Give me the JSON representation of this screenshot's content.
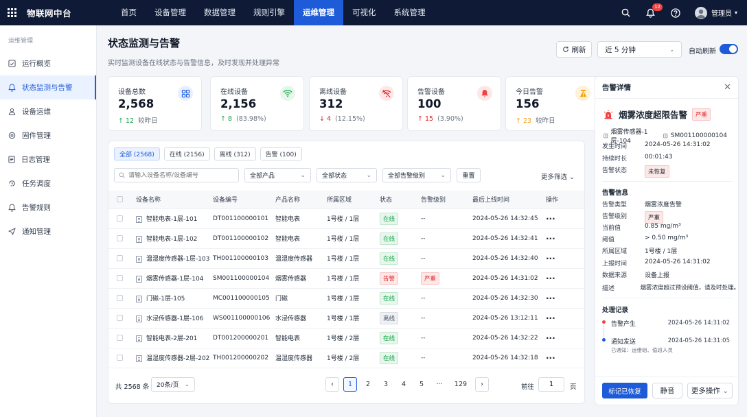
{
  "app": {
    "brand": "物联网中台"
  },
  "nav": [
    {
      "label": "首页",
      "active": false
    },
    {
      "label": "设备管理",
      "active": false
    },
    {
      "label": "数据管理",
      "active": false
    },
    {
      "label": "规则引擎",
      "active": false
    },
    {
      "label": "运维管理",
      "active": true
    },
    {
      "label": "可视化",
      "active": false
    },
    {
      "label": "系统管理",
      "active": false
    }
  ],
  "topbar": {
    "notif_count": "12",
    "username": "管理员"
  },
  "sidebar": {
    "title": "运维管理",
    "items": [
      {
        "label": "运行概览",
        "icon": "chart-icon"
      },
      {
        "label": "状态监测与告警",
        "icon": "bell-icon",
        "active": true
      },
      {
        "label": "设备运维",
        "icon": "user-icon"
      },
      {
        "label": "固件管理",
        "icon": "chip-icon"
      },
      {
        "label": "日志管理",
        "icon": "document-icon"
      },
      {
        "label": "任务调度",
        "icon": "schedule-icon"
      },
      {
        "label": "告警规则",
        "icon": "bell-icon"
      },
      {
        "label": "通知管理",
        "icon": "send-icon"
      }
    ]
  },
  "page": {
    "title": "状态监测与告警",
    "subtitle": "实时监测设备在线状态与告警信息，及时发现并处理异常",
    "refresh_label": "刷新",
    "range": "近 5 分钟",
    "auto_refresh_label": "自动刷新",
    "auto_refresh": true
  },
  "stats": [
    {
      "label": "设备总数",
      "value": "2,568",
      "trend_arrow": "↑",
      "trend_value": "12",
      "trend_note": "较昨日",
      "trend": "up",
      "icon": "device-icon"
    },
    {
      "label": "在线设备",
      "value": "2,156",
      "trend_arrow": "↑",
      "trend_value": "8",
      "trend_note": "(83.98%)",
      "trend": "up",
      "icon": "wifi-icon"
    },
    {
      "label": "离线设备",
      "value": "312",
      "trend_arrow": "↓",
      "trend_value": "4",
      "trend_note": "(12.15%)",
      "trend": "down",
      "icon": "wifi-off-icon"
    },
    {
      "label": "告警设备",
      "value": "100",
      "trend_arrow": "↑",
      "trend_value": "15",
      "trend_note": "(3.90%)",
      "trend": "down",
      "icon": "bell-icon"
    },
    {
      "label": "今日告警",
      "value": "156",
      "trend_arrow": "↑",
      "trend_value": "23",
      "trend_note": "较昨日",
      "trend": "warn",
      "icon": "warning-icon"
    }
  ],
  "tabs": [
    {
      "label": "全部 (2568)",
      "active": true
    },
    {
      "label": "在线 (2156)",
      "active": false
    },
    {
      "label": "离线 (312)",
      "active": false
    },
    {
      "label": "告警 (100)",
      "active": false
    }
  ],
  "filters": {
    "search_placeholder": "请输入设备名称/设备编号",
    "product": "全部产品",
    "status": "全部状态",
    "level": "全部告警级别",
    "reset_label": "重置",
    "more_label": "更多筛选"
  },
  "table": {
    "columns": [
      "设备名称",
      "设备编号",
      "产品名称",
      "所属区域",
      "状态",
      "告警级别",
      "最后上线时间",
      "操作"
    ],
    "rows": [
      {
        "name": "智能电表-1层-101",
        "code": "DT001100000101",
        "product": "智能电表",
        "area": "1号楼 / 1层",
        "status": "在线",
        "status_type": "on",
        "level": "--",
        "time": "2024-05-26 14:32:45"
      },
      {
        "name": "智能电表-1层-102",
        "code": "DT001100000102",
        "product": "智能电表",
        "area": "1号楼 / 1层",
        "status": "在线",
        "status_type": "on",
        "level": "--",
        "time": "2024-05-26 14:32:41"
      },
      {
        "name": "温湿度传感器-1层-103",
        "code": "TH001100000103",
        "product": "温湿度传感器",
        "area": "1号楼 / 1层",
        "status": "在线",
        "status_type": "on",
        "level": "--",
        "time": "2024-05-26 14:32:40"
      },
      {
        "name": "烟雾传感器-1层-104",
        "code": "SM001100000104",
        "product": "烟雾传感器",
        "area": "1号楼 / 1层",
        "status": "告警",
        "status_type": "alarm",
        "level": "严重",
        "time": "2024-05-26 14:31:02"
      },
      {
        "name": "门磁-1层-105",
        "code": "MC001100000105",
        "product": "门磁",
        "area": "1号楼 / 1层",
        "status": "在线",
        "status_type": "on",
        "level": "--",
        "time": "2024-05-26 14:32:30"
      },
      {
        "name": "水浸传感器-1层-106",
        "code": "WS001100000106",
        "product": "水浸传感器",
        "area": "1号楼 / 1层",
        "status": "离线",
        "status_type": "off",
        "level": "--",
        "time": "2024-05-26 13:12:11"
      },
      {
        "name": "智能电表-2层-201",
        "code": "DT001200000201",
        "product": "智能电表",
        "area": "1号楼 / 2层",
        "status": "在线",
        "status_type": "on",
        "level": "--",
        "time": "2024-05-26 14:32:22"
      },
      {
        "name": "温湿度传感器-2层-202",
        "code": "TH001200000202",
        "product": "温湿度传感器",
        "area": "1号楼 / 2层",
        "status": "在线",
        "status_type": "on",
        "level": "--",
        "time": "2024-05-26 14:32:18"
      }
    ]
  },
  "pager": {
    "total": "共 2568 条",
    "page_size": "20条/页",
    "pages": [
      "1",
      "2",
      "3",
      "4",
      "5",
      "···",
      "129"
    ],
    "current": "1",
    "goto_label": "前往",
    "goto_value": "1",
    "page_label": "页"
  },
  "detail": {
    "title": "告警详情",
    "alarm_name": "烟雾浓度超限告警",
    "severity": "严重",
    "device": "烟雾传感器-1层-104",
    "device_code": "SM001100000104",
    "info": [
      {
        "k": "发生时间",
        "v": "2024-05-26 14:31:02"
      },
      {
        "k": "持续时长",
        "v": "00:01:43"
      },
      {
        "k": "告警状态",
        "v": "未恢复",
        "tag": true
      }
    ],
    "section_info": "告警信息",
    "info2": [
      {
        "k": "告警类型",
        "v": "烟雾浓度告警"
      },
      {
        "k": "告警级别",
        "v": "严重",
        "tag": true
      },
      {
        "k": "当前值",
        "v": "0.85 mg/m³"
      },
      {
        "k": "阈值",
        "v": "> 0.50 mg/m³"
      },
      {
        "k": "所属区域",
        "v": "1号楼 / 1层"
      },
      {
        "k": "上报时间",
        "v": "2024-05-26 14:31:02"
      },
      {
        "k": "数据来源",
        "v": "设备上报"
      },
      {
        "k": "描述",
        "v": "烟雾浓度超过预设阈值，请及时处理。"
      }
    ],
    "section_log": "处理记录",
    "log": [
      {
        "label": "告警产生",
        "time": "2024-05-26 14:31:02",
        "color": "#ef4444"
      },
      {
        "label": "通知发送",
        "time": "2024-05-26 14:31:05",
        "sub": "已通知：运维组、值班人员",
        "color": "#1e5bd8"
      }
    ],
    "btn_recover": "标记已恢复",
    "btn_mute": "静音",
    "btn_more": "更多操作"
  }
}
